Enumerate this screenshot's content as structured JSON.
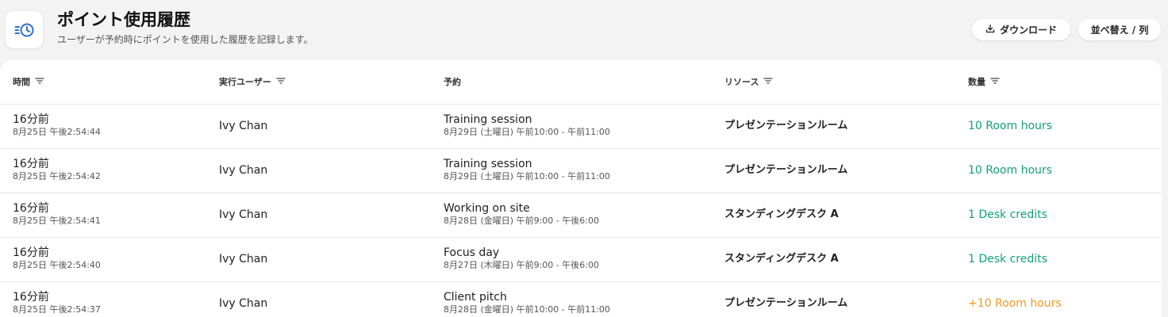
{
  "header": {
    "icon": "history-list-icon",
    "title": "ポイント使用履歴",
    "subtitle": "ユーザーが予約時にポイントを使用した履歴を記録します。",
    "download_label": "ダウンロード",
    "sort_label": "並べ替え / 列"
  },
  "table": {
    "columns": [
      {
        "label": "時間",
        "filter": true
      },
      {
        "label": "実行ユーザー",
        "filter": true
      },
      {
        "label": "予約",
        "filter": false
      },
      {
        "label": "リソース",
        "filter": true
      },
      {
        "label": "数量",
        "filter": true
      }
    ],
    "rows": [
      {
        "relative": "16分前",
        "timestamp": "8月25日 午後2:54:44",
        "user": "Ivy Chan",
        "title": "Training session",
        "schedule": "8月29日 (土曜日) 午前10:00 - 午前11:00",
        "resource": "プレゼンテーションルーム",
        "amount": "10 Room hours",
        "kind": "debit"
      },
      {
        "relative": "16分前",
        "timestamp": "8月25日 午後2:54:42",
        "user": "Ivy Chan",
        "title": "Training session",
        "schedule": "8月29日 (土曜日) 午前10:00 - 午前11:00",
        "resource": "プレゼンテーションルーム",
        "amount": "10 Room hours",
        "kind": "debit"
      },
      {
        "relative": "16分前",
        "timestamp": "8月25日 午後2:54:41",
        "user": "Ivy Chan",
        "title": "Working on site",
        "schedule": "8月28日 (金曜日) 午前9:00 - 午後6:00",
        "resource": "スタンディングデスク A",
        "amount": "1 Desk credits",
        "kind": "debit"
      },
      {
        "relative": "16分前",
        "timestamp": "8月25日 午後2:54:40",
        "user": "Ivy Chan",
        "title": "Focus day",
        "schedule": "8月27日 (木曜日) 午前9:00 - 午後6:00",
        "resource": "スタンディングデスク A",
        "amount": "1 Desk credits",
        "kind": "debit"
      },
      {
        "relative": "16分前",
        "timestamp": "8月25日 午後2:54:37",
        "user": "Ivy Chan",
        "title": "Client pitch",
        "schedule": "8月28日 (金曜日) 午前10:00 - 午前11:00",
        "resource": "プレゼンテーションルーム",
        "amount": "+10 Room hours",
        "kind": "credit"
      }
    ]
  },
  "colors": {
    "accent": "#2f6fd1",
    "debit": "#12a07a",
    "credit": "#f19a1f"
  }
}
